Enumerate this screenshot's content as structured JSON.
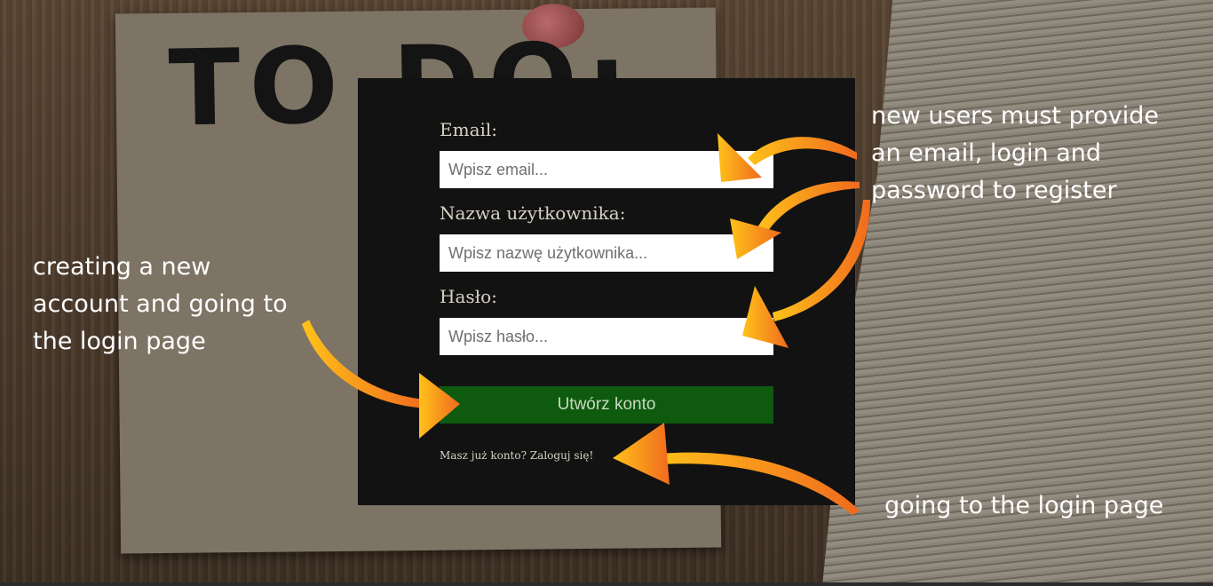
{
  "background": {
    "note_text": "TO DO:"
  },
  "form": {
    "email_label": "Email:",
    "email_placeholder": "Wpisz email...",
    "username_label": "Nazwa użytkownika:",
    "username_placeholder": "Wpisz nazwę użytkownika...",
    "password_label": "Hasło:",
    "password_placeholder": "Wpisz hasło...",
    "submit_label": "Utwórz konto",
    "login_link": "Masz już konto? Zaloguj się!"
  },
  "annotations": {
    "register_fields": "new users must provide\nan email, login and\npassword to register",
    "create_account": "creating a new\naccount and going to\nthe login page",
    "go_login": "going to the login page"
  },
  "colors": {
    "arrow": "#f28a1e",
    "submit_bg": "#0e5a0e",
    "panel_bg": "#121212"
  }
}
